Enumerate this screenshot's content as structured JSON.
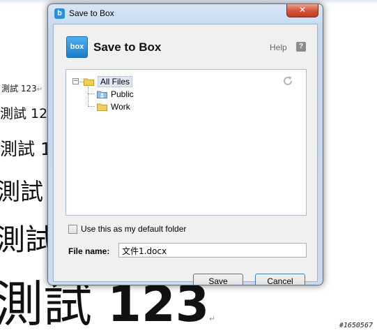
{
  "document": {
    "lines": [
      "測試 123",
      "測試 123",
      "測試 1",
      "測試",
      "測試",
      "測試 "
    ],
    "big_number": "123",
    "paragraph_mark": "↵",
    "watermark": "#1650567"
  },
  "dialog": {
    "title": "Save to Box",
    "close_symbol": "✕",
    "header": {
      "logo_text": "box",
      "title": "Save to Box",
      "help": "Help",
      "help_icon": "?"
    },
    "tree": {
      "expander": "−",
      "root": "All Files",
      "children": [
        "Public",
        "Work"
      ]
    },
    "default_folder_label": "Use this as my default folder",
    "filename_label": "File name:",
    "filename_value": "文件1.docx",
    "buttons": {
      "save": "Save",
      "cancel": "Cancel"
    },
    "colors": {
      "close": "#c33a20",
      "box_blue": "#2f8fd6",
      "folder": "#f3cf57"
    }
  }
}
